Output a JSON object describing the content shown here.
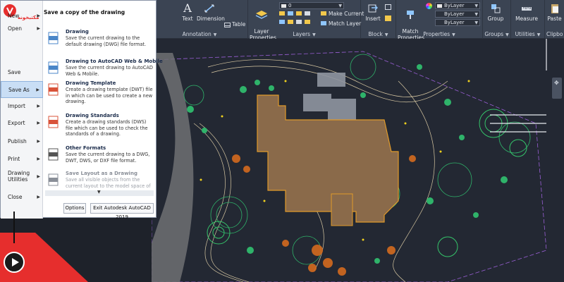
{
  "brand": {
    "logo_text": "مکتبخونه",
    "accent": "#e62e2d"
  },
  "ribbon": {
    "groups": [
      {
        "title": "Annotation"
      },
      {
        "title": "Layers"
      },
      {
        "title": "Block"
      },
      {
        "title": "Properties"
      },
      {
        "title": "Groups"
      },
      {
        "title": "Utilities"
      },
      {
        "title": "Clipbo"
      }
    ],
    "buttons": {
      "text": "Text",
      "dimension": "Dimension",
      "table": "Table",
      "layer_properties": "Layer\nProperties",
      "make_current": "Make Current",
      "match_layer": "Match Layer",
      "insert": "Insert",
      "match_properties": "Match\nProperties",
      "group": "Group",
      "measure": "Measure",
      "paste": "Paste"
    },
    "layer_combo": "0",
    "bylayer_1": "ByLayer",
    "bylayer_2": "ByLayer",
    "bylayer_3": "ByLayer"
  },
  "app_menu": {
    "left_items": [
      {
        "label": "New",
        "has_sub": true
      },
      {
        "label": "Open",
        "has_sub": true
      },
      {
        "label": "Save",
        "has_sub": false
      },
      {
        "label": "Save As",
        "has_sub": true
      },
      {
        "label": "Import",
        "has_sub": true
      },
      {
        "label": "Export",
        "has_sub": true
      },
      {
        "label": "Publish",
        "has_sub": true
      },
      {
        "label": "Print",
        "has_sub": true
      },
      {
        "label": "Drawing Utilities",
        "has_sub": true
      },
      {
        "label": "Close",
        "has_sub": true
      }
    ],
    "heading": "Save a copy of the drawing",
    "options": [
      {
        "title": "Drawing",
        "desc": "Save the current drawing to the default drawing (DWG) file format."
      },
      {
        "title": "Drawing to AutoCAD Web & Mobile",
        "desc": "Save the current drawing to AutoCAD Web & Mobile."
      },
      {
        "title": "Drawing Template",
        "desc": "Create a drawing template (DWT) file in which can be used to create a new drawing."
      },
      {
        "title": "Drawing Standards",
        "desc": "Create a drawing standards (DWS) file which can be used to check the standards of a drawing."
      },
      {
        "title": "Other Formats",
        "desc": "Save the current drawing to a DWG, DWT, DWS, or DXF file format."
      },
      {
        "title": "Save Layout as a Drawing",
        "desc": "Save all visible objects from the current layout to the model space of a new"
      }
    ],
    "options_button": "Options",
    "exit_button": "Exit Autodesk AutoCAD 2019"
  }
}
